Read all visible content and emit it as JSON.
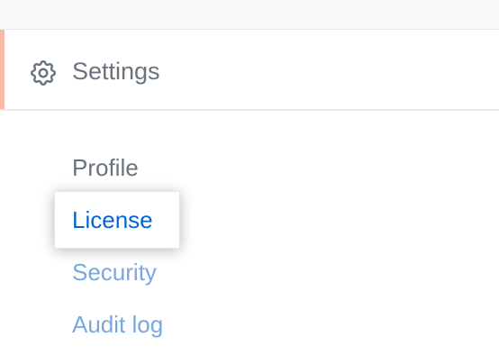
{
  "nav": {
    "settings_label": "Settings",
    "settings_icon": "gear-icon",
    "active_indicator_color": "#f9b9a8",
    "section_heading": "Profile",
    "items": [
      {
        "label": "License",
        "state": "highlighted"
      },
      {
        "label": "Security",
        "state": "default"
      },
      {
        "label": "Audit log",
        "state": "default"
      }
    ]
  },
  "colors": {
    "muted_text": "#6a737d",
    "link": "#79a8e0",
    "link_active": "#0366d6"
  }
}
